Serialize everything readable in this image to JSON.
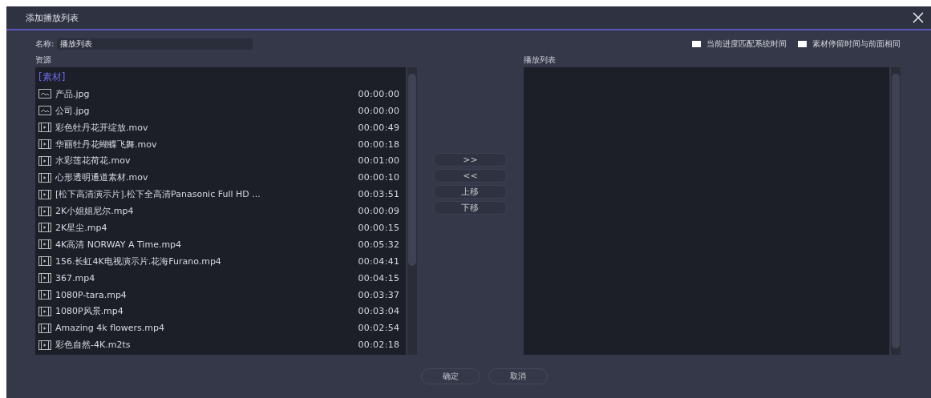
{
  "window": {
    "title": "添加播放列表"
  },
  "name_field": {
    "label": "名称:",
    "value": "播放列表"
  },
  "options": [
    {
      "label": "当前进度匹配系统时间",
      "checked": false
    },
    {
      "label": "素材停留时间与前面相同",
      "checked": false
    }
  ],
  "source": {
    "label": "资源",
    "group": "[素材]",
    "items": [
      {
        "kind": "image",
        "name": "产品.jpg",
        "duration": "00:00:00"
      },
      {
        "kind": "image",
        "name": "公司.jpg",
        "duration": "00:00:00"
      },
      {
        "kind": "video",
        "name": "彩色牡丹花开绽放.mov",
        "duration": "00:00:49"
      },
      {
        "kind": "video",
        "name": "华丽牡丹花蝴蝶飞舞.mov",
        "duration": "00:00:18"
      },
      {
        "kind": "video",
        "name": "水彩莲花荷花.mov",
        "duration": "00:01:00"
      },
      {
        "kind": "video",
        "name": "心形透明通道素材.mov",
        "duration": "00:00:10"
      },
      {
        "kind": "video",
        "name": "[松下高清演示片].松下全高清Panasonic Full HD ...",
        "duration": "00:03:51"
      },
      {
        "kind": "video",
        "name": "2K小姐姐尼尔.mp4",
        "duration": "00:00:09"
      },
      {
        "kind": "video",
        "name": "2K星尘.mp4",
        "duration": "00:00:15"
      },
      {
        "kind": "video",
        "name": "4K高清 NORWAY A Time.mp4",
        "duration": "00:05:32"
      },
      {
        "kind": "video",
        "name": "156.长虹4K电视演示片.花海Furano.mp4",
        "duration": "00:04:41"
      },
      {
        "kind": "video",
        "name": "367.mp4",
        "duration": "00:04:15"
      },
      {
        "kind": "video",
        "name": "1080P-tara.mp4",
        "duration": "00:03:37"
      },
      {
        "kind": "video",
        "name": "1080P风景.mp4",
        "duration": "00:03:04"
      },
      {
        "kind": "video",
        "name": "Amazing 4k flowers.mp4",
        "duration": "00:02:54"
      },
      {
        "kind": "video",
        "name": "彩色自然-4K.m2ts",
        "duration": "00:02:18"
      }
    ]
  },
  "transfer_buttons": [
    ">>",
    "<<",
    "上移",
    "下移"
  ],
  "playlist": {
    "label": "播放列表"
  },
  "buttons": [
    "确定",
    "取消"
  ]
}
